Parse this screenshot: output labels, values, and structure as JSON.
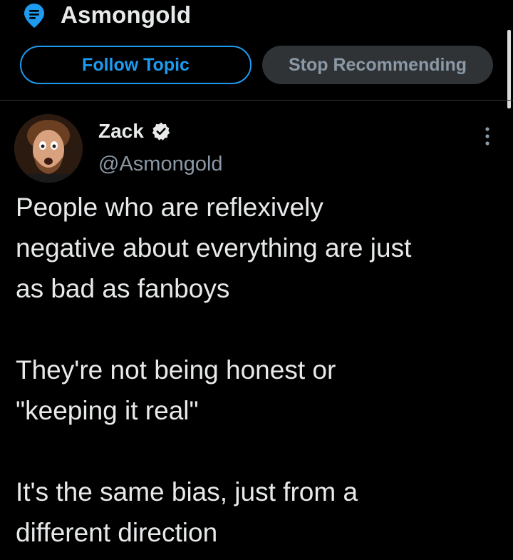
{
  "topic": {
    "title": "Asmongold",
    "icon": "topic-pin-icon",
    "accent_color": "#1d9bf0",
    "follow_label": "Follow Topic",
    "stop_label": "Stop Recommending"
  },
  "tweet": {
    "author_name": "Zack",
    "handle": "@Asmongold",
    "verified": true,
    "avatar_icon": "avatar",
    "more_icon": "more-vertical-icon",
    "paragraphs": [
      "People who are reflexively\nnegative about everything are just\nas bad as fanboys",
      "They're not being honest or\n\"keeping it real\"",
      "It's the same bias, just from a\ndifferent direction"
    ]
  }
}
